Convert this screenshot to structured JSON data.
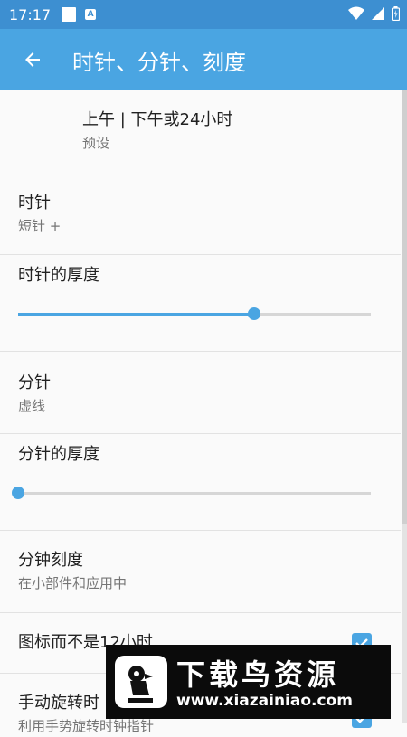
{
  "status_bar": {
    "time": "17:17",
    "notif_letter": "A"
  },
  "app_bar": {
    "title": "时针、分针、刻度"
  },
  "items": [
    {
      "title": "上午 | 下午或24小时",
      "subtitle": "预设"
    },
    {
      "title": "时针",
      "subtitle": "短针 +"
    },
    {
      "title": "时针的厚度",
      "slider_value": 0.67
    },
    {
      "title": "分针",
      "subtitle": "虚线"
    },
    {
      "title": "分针的厚度",
      "slider_value": 0.0
    },
    {
      "title": "分钟刻度",
      "subtitle": "在小部件和应用中"
    },
    {
      "title": "图标而不是12小时",
      "checked": true
    },
    {
      "title": "手动旋转时",
      "subtitle": "利用手势旋转时钟指针",
      "checked": true
    }
  ],
  "watermark": {
    "main": "下载鸟资源",
    "url": "www.xiazainiao.com"
  },
  "colors": {
    "status_bar": "#3d8fd1",
    "app_bar": "#4aa5e2",
    "accent": "#4aa5e2"
  }
}
